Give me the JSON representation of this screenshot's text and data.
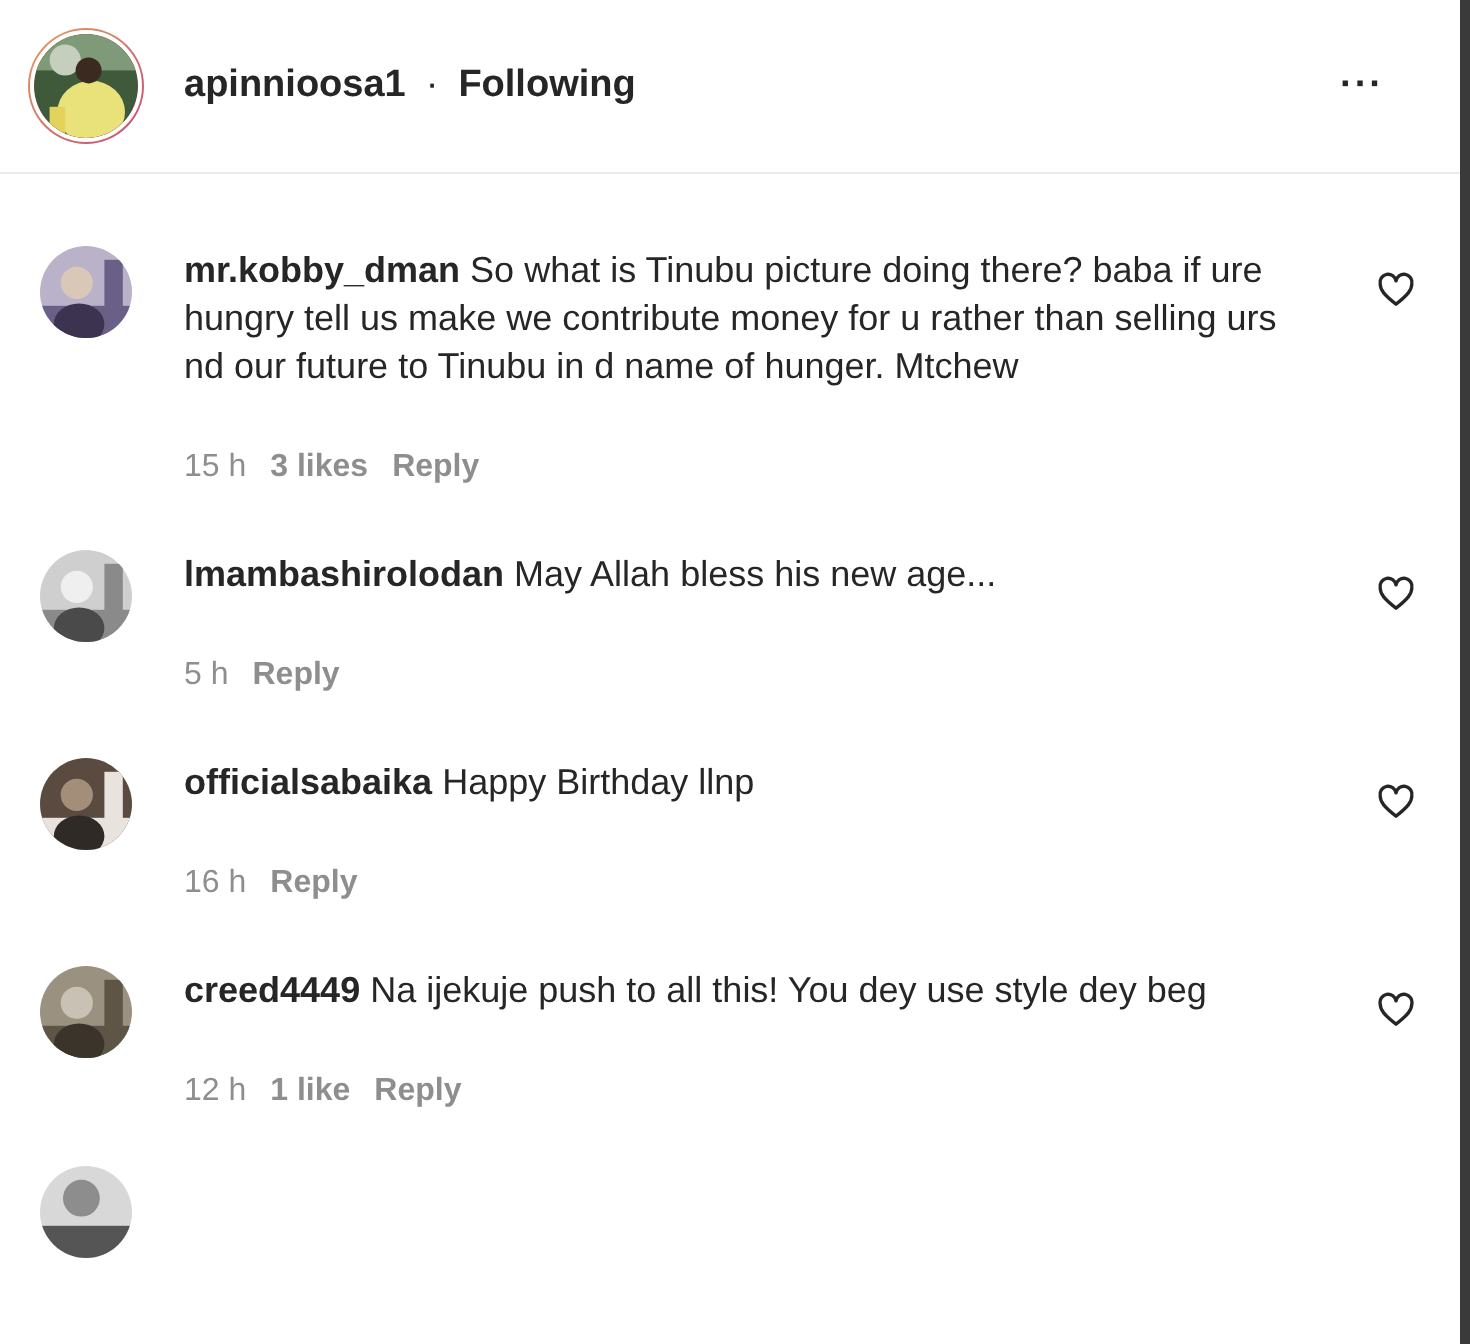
{
  "header": {
    "username": "apinnioosa1",
    "separator": "·",
    "follow_status": "Following",
    "more": "···"
  },
  "comments": [
    {
      "username": "mr.kobby_dman",
      "text": "So what is Tinubu picture doing there? baba if ure hungry tell us make we contribute money for u rather than selling urs nd our future to Tinubu in d name of hunger. Mtchew",
      "time": "15 h",
      "likes": "3 likes",
      "reply": "Reply",
      "liked": false
    },
    {
      "username": "lmambashirolodan",
      "text": "May Allah bless his new age...",
      "time": "5 h",
      "reply": "Reply",
      "liked": false
    },
    {
      "username": "officialsabaika",
      "text": "Happy Birthday llnp",
      "time": "16 h",
      "reply": "Reply",
      "liked": false
    },
    {
      "username": "creed4449",
      "text": "Na ijekuje push to all this! You dey use style dey beg",
      "time": "12 h",
      "likes": "1 like",
      "reply": "Reply",
      "liked": false
    }
  ]
}
